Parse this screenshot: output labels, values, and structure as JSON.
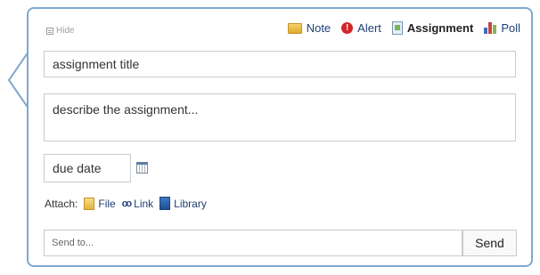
{
  "header": {
    "hide_label": "Hide",
    "post_types": [
      {
        "label": "Note",
        "icon": "note-icon"
      },
      {
        "label": "Alert",
        "icon": "alert-icon"
      },
      {
        "label": "Assignment",
        "icon": "assignment-icon",
        "active": true
      },
      {
        "label": "Poll",
        "icon": "poll-icon"
      }
    ]
  },
  "form": {
    "title_placeholder": "assignment title",
    "description_placeholder": "describe the assignment...",
    "due_date_placeholder": "due date"
  },
  "attach": {
    "label": "Attach:",
    "items": [
      {
        "label": "File",
        "icon": "file-icon"
      },
      {
        "label": "Link",
        "icon": "link-icon"
      },
      {
        "label": "Library",
        "icon": "library-icon"
      }
    ]
  },
  "send": {
    "to_placeholder": "Send to...",
    "button_label": "Send"
  },
  "colors": {
    "border": "#7fa8cf",
    "link": "#1f3f77",
    "alert": "#d4262a",
    "poll_bars": [
      "#3f6fb6",
      "#c34745",
      "#8bb153"
    ]
  }
}
